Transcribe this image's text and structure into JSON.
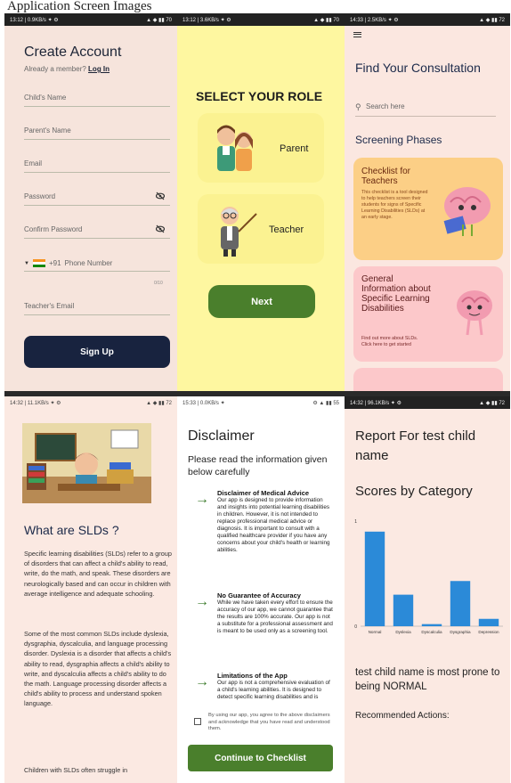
{
  "page_title": "Application Screen Images",
  "screens": {
    "create_account": {
      "status_left": "13:12 | 0.9KB/s ✦ ⚙",
      "status_right": "▲ ◆ ▮▮ 70",
      "title": "Create Account",
      "already_member": "Already a member?",
      "login_link": "Log In",
      "fields": {
        "child_name": "Child's Name",
        "parent_name": "Parent's Name",
        "email": "Email",
        "password": "Password",
        "confirm_password": "Confirm Password",
        "country_code": "+91",
        "phone": "Phone Number",
        "phone_counter": "0/10",
        "teacher_email": "Teacher's Email"
      },
      "signup_button": "Sign Up"
    },
    "select_role": {
      "status_left": "13:12 | 3.6KB/s ✦ ⚙",
      "status_right": "▲ ◆ ▮▮ 70",
      "title": "SELECT YOUR ROLE",
      "parent_label": "Parent",
      "teacher_label": "Teacher",
      "next_button": "Next"
    },
    "consultation": {
      "status_left": "14:33 | 2.5KB/s ✦ ⚙",
      "status_right": "▲ ◆ ▮▮ 72",
      "title": "Find Your Consultation",
      "search_placeholder": "Search here",
      "section": "Screening Phases",
      "card1_title": "Checklist for Teachers",
      "card1_text": "This checklist is a tool designed to help teachers screen their students for signs of Specific Learning Disabilities (SLDs) at an early stage.",
      "card2_title": "General Information about Specific Learning Disabilities",
      "card2_text": "Find out more about SLDs. Click here to get started"
    },
    "what_are_slds": {
      "status_left": "14:32 | 11.1KB/s ✦ ⚙",
      "status_right": "▲ ◆ ▮▮ 72",
      "title": "What are SLDs ?",
      "para1": "Specific learning disabilities (SLDs) refer to a group of disorders that can affect a child's ability to read, write, do the math, and speak. These disorders are neurologically based and can occur in children with average intelligence and adequate schooling.",
      "para2": "Some of the most common SLDs include dyslexia, dysgraphia, dyscalculia, and language processing disorder. Dyslexia is a disorder that affects a child's ability to read, dysgraphia affects a child's ability to write, and dyscalculia affects a child's ability to do the math. Language processing disorder affects a child's ability to process and understand spoken language.",
      "para3": "Children with SLDs often struggle in"
    },
    "disclaimer": {
      "status_left": "15:33 | 0.0KB/s ✦",
      "status_right": "⚙ ▲ ▮▮ 55",
      "title": "Disclaimer",
      "subtitle": "Please read the information given below carefully",
      "items": [
        {
          "heading": "Disclaimer of Medical Advice",
          "text": "Our app is designed to provide information and insights into potential learning disabilities in children. However, it is not intended to replace professional medical advice or diagnosis. It is important to consult with a qualified healthcare provider if you have any concerns about your child's health or learning abilities."
        },
        {
          "heading": "No Guarantee of Accuracy",
          "text": "While we have taken every effort to ensure the accuracy of our app, we cannot guarantee that the results are 100% accurate. Our app is not a substitute for a professional assessment and is meant to be used only as a screening tool."
        },
        {
          "heading": "Limitations of the App",
          "text": "Our app is not a comprehensive evaluation of a child's learning abilities. It is designed to detect specific learning disabilities and is"
        }
      ],
      "agree_text": "By using our app, you agree to the above disclaimers and acknowledge that you have read and understood them.",
      "continue_button": "Continue to Checklist"
    },
    "report": {
      "status_left": "14:32 | 96.1KB/s ✦ ⚙",
      "status_right": "▲ ◆ ▮▮ 72",
      "title": "Report For test child name",
      "scores_title": "Scores by Category",
      "result_text": "test child name is most prone to being NORMAL",
      "recommended": "Recommended Actions:"
    }
  },
  "colors": {
    "create_bg": "#f6e4dc",
    "role_bg": "#fef7a0",
    "consult_bg": "#fbe7e0",
    "green": "#4a7f2c",
    "navy": "#18233f",
    "bar": "#2b8ad8",
    "card1": "#fccf86",
    "card2": "#fcc8ca"
  },
  "chart_data": {
    "type": "bar",
    "categories": [
      "Normal",
      "Dyslexia",
      "Dyscalculia",
      "Dysgraphia",
      "Depression"
    ],
    "values": [
      0.9,
      0.3,
      0.02,
      0.43,
      0.07
    ],
    "ylim": [
      0,
      1
    ],
    "yticks": [
      "0",
      "1"
    ],
    "grid": false,
    "legend": false
  }
}
